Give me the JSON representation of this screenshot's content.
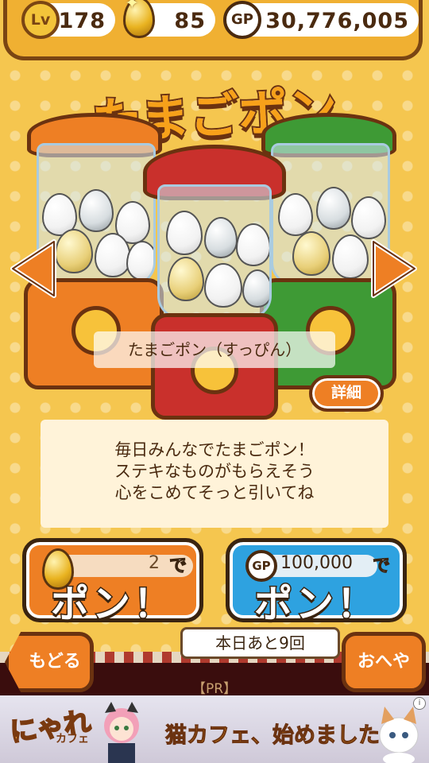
{
  "status": {
    "level_label": "Lv",
    "level": "178",
    "eggs": "85",
    "gp_label": "GP",
    "gp": "30,776,005"
  },
  "title": "たまごポン",
  "gacha": {
    "name": "たまごポン（すっぴん）",
    "detail_label": "詳細",
    "description": [
      "毎日みんなでたまごポン！",
      "ステキなものがもらえそう",
      "心をこめてそっと引いてね"
    ]
  },
  "pon_egg": {
    "cost": "2",
    "de": "で",
    "label": "ポン！"
  },
  "pon_gp": {
    "gp_label": "GP",
    "cost": "100,000",
    "de": "で",
    "label": "ポン！"
  },
  "remaining": "本日あと9回",
  "nav": {
    "back": "もどる",
    "room": "おへや"
  },
  "pr_label": "【PR】",
  "ad": {
    "logo": "にゃれ",
    "logo_sub": "カフェ",
    "text": "猫カフェ、始めました",
    "info": "i"
  },
  "icons": [
    "lv-icon",
    "golden-egg-icon",
    "gp-coin-icon",
    "arrow-left-icon",
    "arrow-right-icon"
  ],
  "colors": {
    "bg": "#f5c64f",
    "orange": "#ee7f24",
    "blue": "#2ea2e0",
    "red": "#c9302c",
    "green": "#3e9a35",
    "outline": "#6b3210"
  }
}
